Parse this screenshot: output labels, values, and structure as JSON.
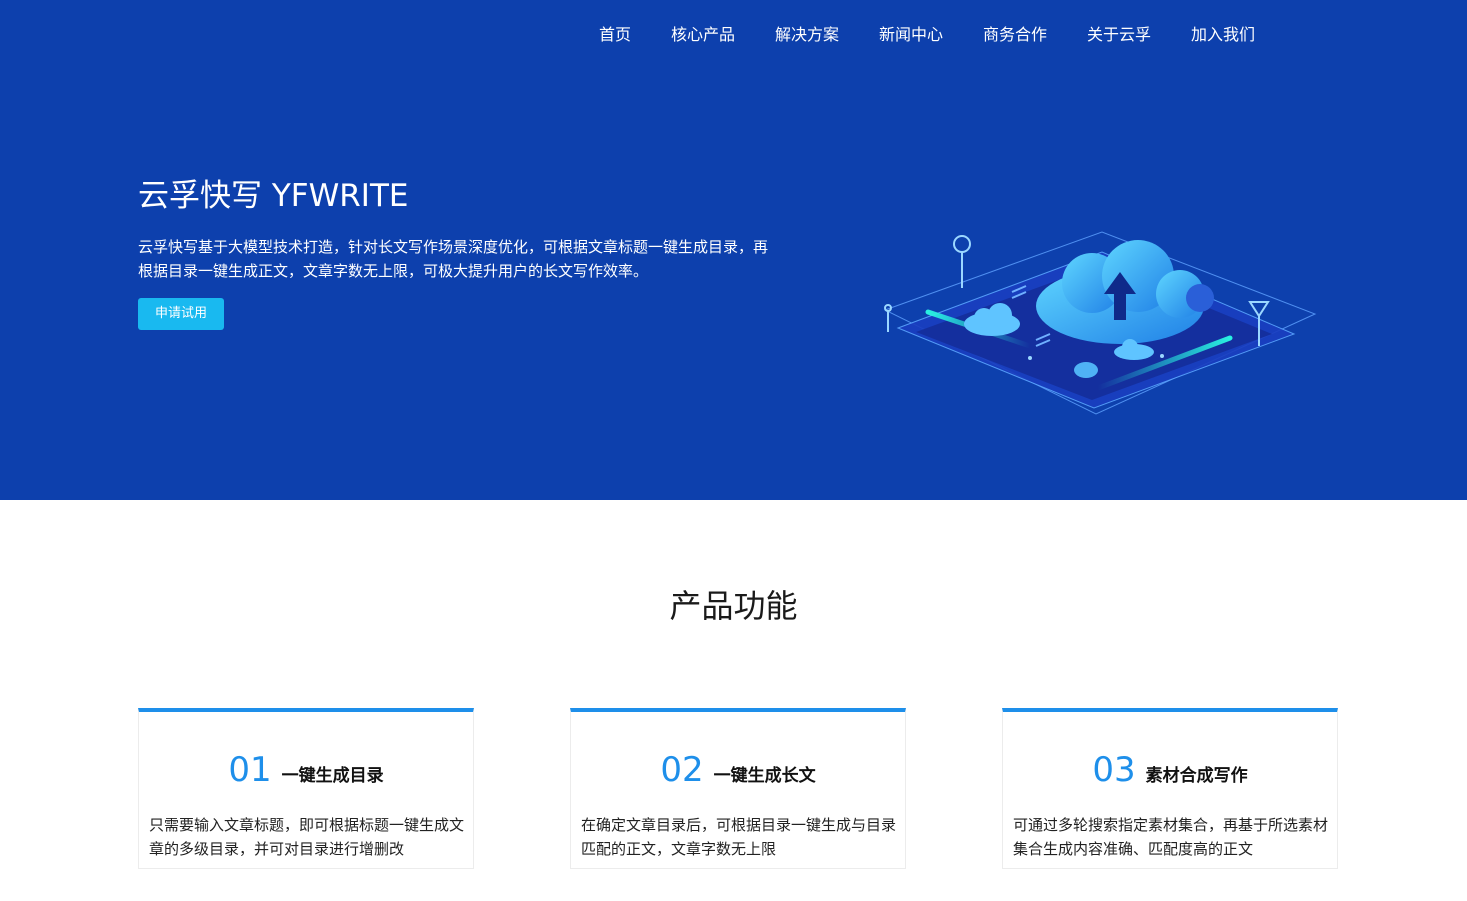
{
  "nav": {
    "items": [
      "首页",
      "核心产品",
      "解决方案",
      "新闻中心",
      "商务合作",
      "关于云孚",
      "加入我们"
    ]
  },
  "hero": {
    "title": "云孚快写 YFWRITE",
    "description": "云孚快写基于大模型技术打造，针对长文写作场景深度优化，可根据文章标题一键生成目录，再根据目录一键生成正文，文章字数无上限，可极大提升用户的长文写作效率。",
    "button_label": "申请试用"
  },
  "features": {
    "title": "产品功能",
    "cards": [
      {
        "number": "01",
        "name": "一键生成目录",
        "description": "只需要输入文章标题，即可根据标题一键生成文章的多级目录，并可对目录进行增删改"
      },
      {
        "number": "02",
        "name": "一键生成长文",
        "description": "在确定文章目录后，可根据目录一键生成与目录匹配的正文，文章字数无上限"
      },
      {
        "number": "03",
        "name": "素材合成写作",
        "description": "可通过多轮搜索指定素材集合，再基于所选素材集合生成内容准确、匹配度高的正文"
      }
    ]
  },
  "colors": {
    "hero_bg": "#0d40ad",
    "accent": "#1e8fea",
    "button": "#19b9f0"
  }
}
